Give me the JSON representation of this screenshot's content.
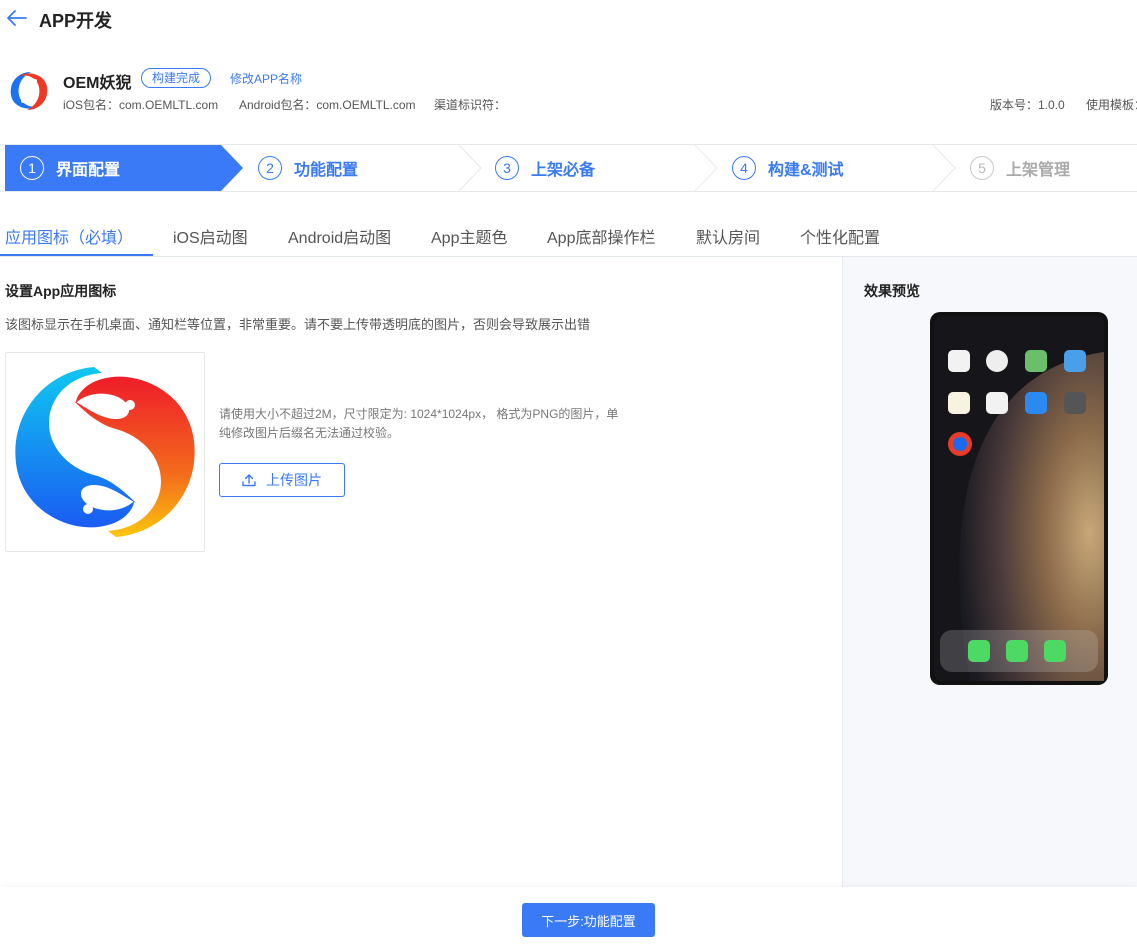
{
  "header": {
    "title": "APP开发"
  },
  "app": {
    "name": "OEM妖猊",
    "status": "构建完成",
    "rename_label": "修改APP名称",
    "ios_package": "iOS包名：com.OEMLTL.com",
    "android_package": "Android包名：com.OEMLTL.com",
    "channel": "渠道标识符：",
    "version": "版本号：1.0.0",
    "template": "使用模板："
  },
  "steps": [
    {
      "num": "1",
      "label": "界面配置",
      "state": "active"
    },
    {
      "num": "2",
      "label": "功能配置",
      "state": "normal"
    },
    {
      "num": "3",
      "label": "上架必备",
      "state": "normal"
    },
    {
      "num": "4",
      "label": "构建&测试",
      "state": "normal"
    },
    {
      "num": "5",
      "label": "上架管理",
      "state": "disabled"
    }
  ],
  "tabs": [
    {
      "label": "应用图标（必填）",
      "active": true
    },
    {
      "label": "iOS启动图"
    },
    {
      "label": "Android启动图"
    },
    {
      "label": "App主题色"
    },
    {
      "label": "App底部操作栏"
    },
    {
      "label": "默认房间"
    },
    {
      "label": "个性化配置"
    }
  ],
  "section": {
    "title": "设置App应用图标",
    "description": "该图标显示在手机桌面、通知栏等位置，非常重要。请不要上传带透明底的图片，否则会导致展示出错",
    "hint": "请使用大小不超过2M，尺寸限定为: 1024*1024px， 格式为PNG的图片，单纯修改图片后缀名无法通过校验。",
    "upload_label": "上传图片"
  },
  "preview": {
    "title": "效果预览"
  },
  "footer": {
    "next_label": "下一步:功能配置"
  },
  "colors": {
    "accent": "#3a7af6",
    "active_step": "#3a7af6",
    "preview_bg": "#f6f8fb"
  }
}
